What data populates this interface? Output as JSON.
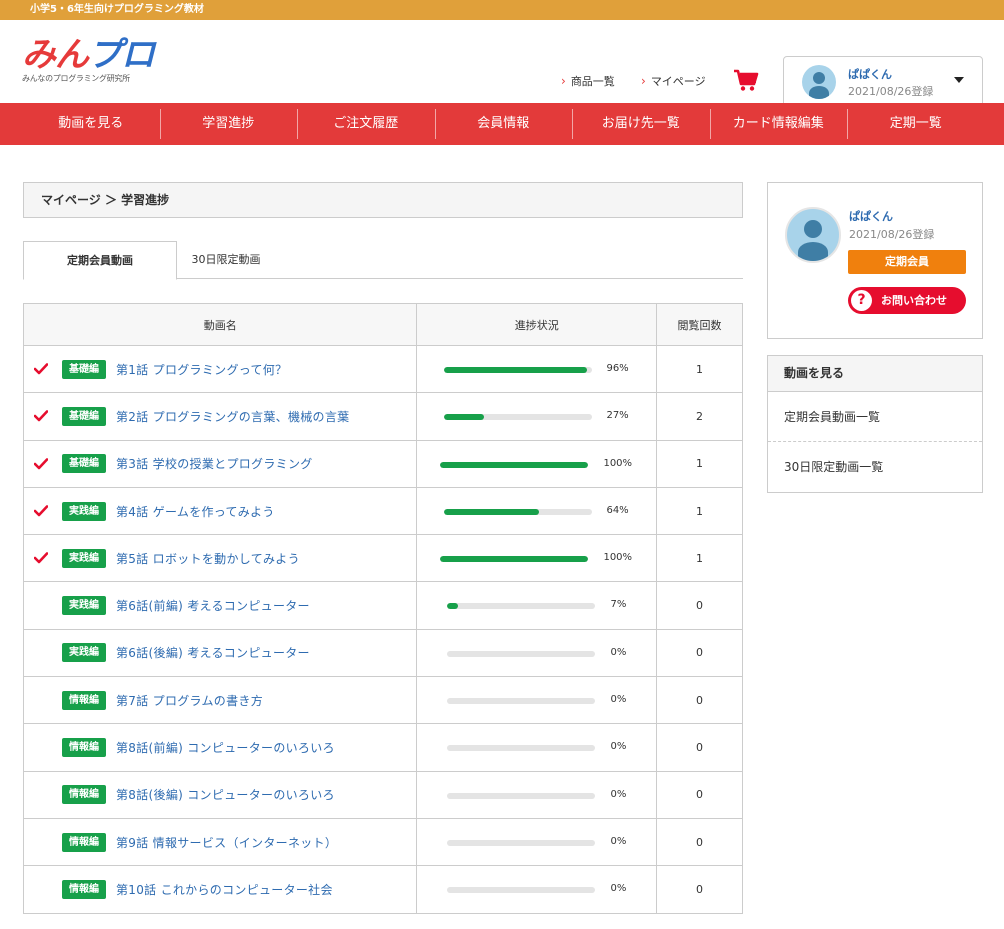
{
  "topbar": {
    "text": "小学5・6年生向けプログラミング教材"
  },
  "logo": {
    "part1": "みん",
    "part2": "プロ",
    "subtitle": "みんなのプログラミング研究所"
  },
  "header_links": {
    "products": "商品一覧",
    "mypage": "マイページ"
  },
  "user": {
    "name": "ぱぱくん",
    "registered": "2021/08/26登録"
  },
  "nav": [
    "動画を見る",
    "学習進捗",
    "ご注文履歴",
    "会員情報",
    "お届け先一覧",
    "カード情報編集",
    "定期一覧"
  ],
  "breadcrumb": "マイページ ＞ 学習進捗",
  "tabs": {
    "active": "定期会員動画",
    "other": "30日限定動画"
  },
  "table": {
    "headers": {
      "name": "動画名",
      "progress": "進捗状況",
      "views": "閲覧回数"
    },
    "rows": [
      {
        "checked": true,
        "category": "基礎編",
        "title": "第1話 プログラミングって何？",
        "progress": 96,
        "progress_label": "96%",
        "views": "1"
      },
      {
        "checked": true,
        "category": "基礎編",
        "title": "第2話 プログラミングの言葉、機械の言葉",
        "progress": 27,
        "progress_label": "27%",
        "views": "2"
      },
      {
        "checked": true,
        "category": "基礎編",
        "title": "第3話 学校の授業とプログラミング",
        "progress": 100,
        "progress_label": "100%",
        "views": "1"
      },
      {
        "checked": true,
        "category": "実践編",
        "title": "第4話 ゲームを作ってみよう",
        "progress": 64,
        "progress_label": "64%",
        "views": "1"
      },
      {
        "checked": true,
        "category": "実践編",
        "title": "第5話 ロボットを動かしてみよう",
        "progress": 100,
        "progress_label": "100%",
        "views": "1"
      },
      {
        "checked": false,
        "category": "実践編",
        "title": "第6話(前編) 考えるコンピューター",
        "progress": 7,
        "progress_label": "7%",
        "views": "0"
      },
      {
        "checked": false,
        "category": "実践編",
        "title": "第6話(後編) 考えるコンピューター",
        "progress": 0,
        "progress_label": "0%",
        "views": "0"
      },
      {
        "checked": false,
        "category": "情報編",
        "title": "第7話 プログラムの書き方",
        "progress": 0,
        "progress_label": "0%",
        "views": "0"
      },
      {
        "checked": false,
        "category": "情報編",
        "title": "第8話(前編) コンピューターのいろいろ",
        "progress": 0,
        "progress_label": "0%",
        "views": "0"
      },
      {
        "checked": false,
        "category": "情報編",
        "title": "第8話(後編) コンピューターのいろいろ",
        "progress": 0,
        "progress_label": "0%",
        "views": "0"
      },
      {
        "checked": false,
        "category": "情報編",
        "title": "第9話 情報サービス（インターネット）",
        "progress": 0,
        "progress_label": "0%",
        "views": "0"
      },
      {
        "checked": false,
        "category": "情報編",
        "title": "第10話 これからのコンピューター社会",
        "progress": 0,
        "progress_label": "0%",
        "views": "0"
      }
    ]
  },
  "side_card": {
    "member_label": "定期会員",
    "contact_label": "お問い合わせ",
    "contact_icon": "?"
  },
  "side_menu": {
    "title": "動画を見る",
    "items": [
      "定期会員動画一覧",
      "30日限定動画一覧"
    ]
  },
  "colors": {
    "topbar": "#e0a03a",
    "nav": "#e33a3a",
    "badge": "#17a04a",
    "progress": "#17a04a",
    "member": "#f0800d",
    "contact": "#e60d2e",
    "link": "#2e6bb0"
  },
  "icons": {
    "cart": "cart-icon",
    "check": "check-icon",
    "avatar": "avatar-icon",
    "chevron": "chevron-right-icon",
    "caret": "caret-down-icon"
  }
}
